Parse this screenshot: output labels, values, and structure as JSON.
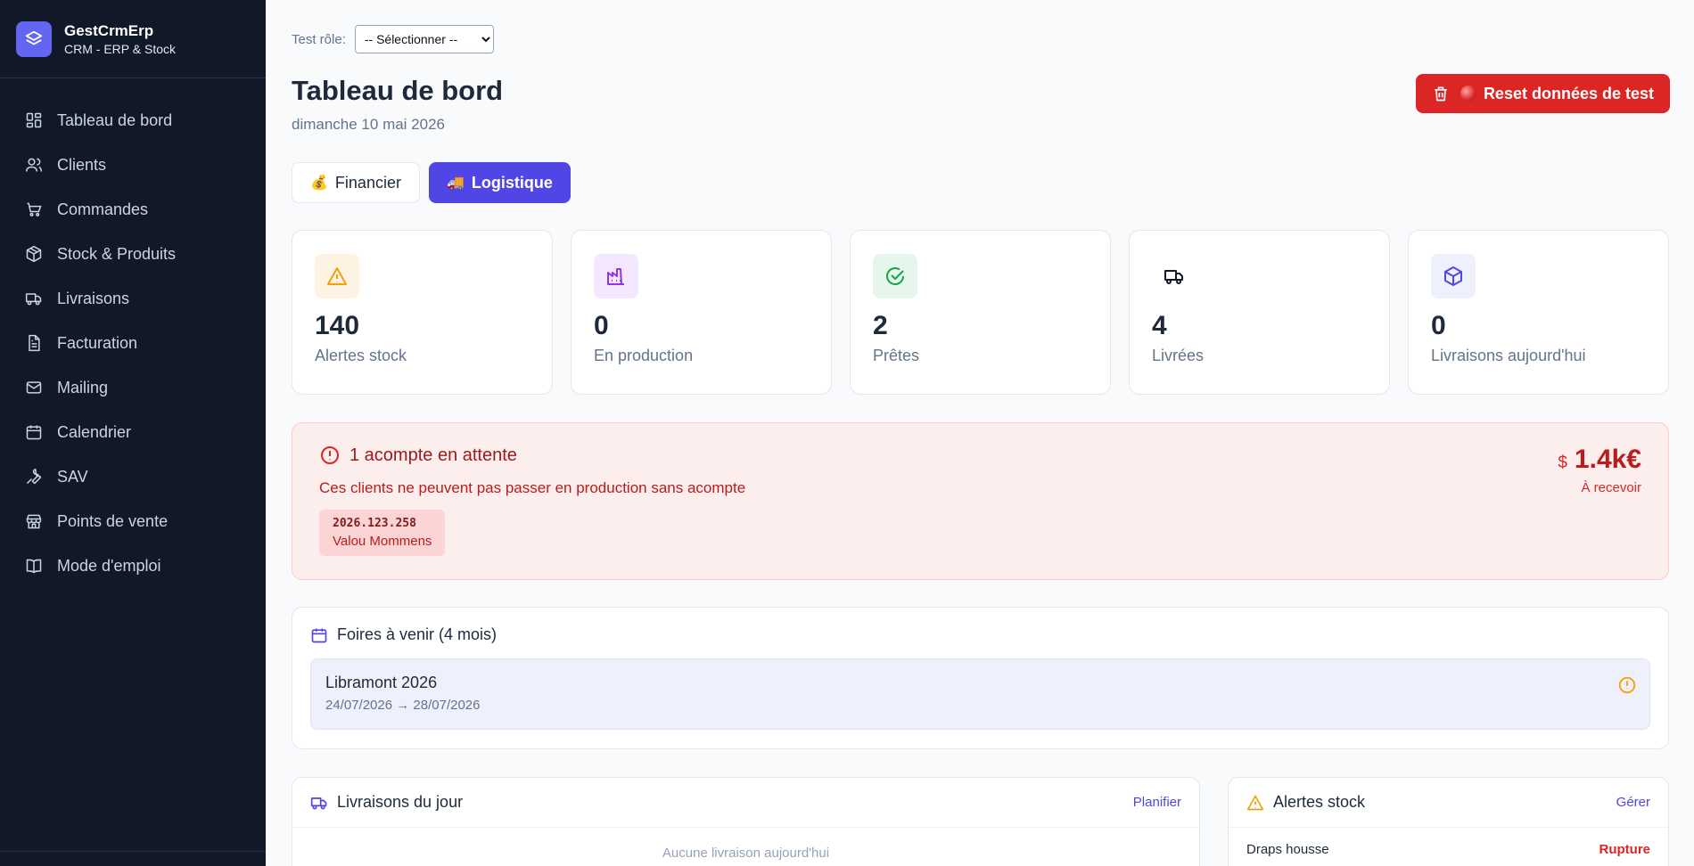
{
  "brand": {
    "name": "GestCrmErp",
    "subtitle": "CRM - ERP & Stock"
  },
  "sidebar": {
    "items": [
      {
        "label": "Tableau de bord",
        "icon": "dashboard-icon"
      },
      {
        "label": "Clients",
        "icon": "users-icon"
      },
      {
        "label": "Commandes",
        "icon": "cart-icon"
      },
      {
        "label": "Stock & Produits",
        "icon": "box-icon"
      },
      {
        "label": "Livraisons",
        "icon": "truck-icon"
      },
      {
        "label": "Facturation",
        "icon": "invoice-icon"
      },
      {
        "label": "Mailing",
        "icon": "mail-icon"
      },
      {
        "label": "Calendrier",
        "icon": "calendar-icon"
      },
      {
        "label": "SAV",
        "icon": "wrench-icon"
      },
      {
        "label": "Points de vente",
        "icon": "store-icon"
      },
      {
        "label": "Mode d'emploi",
        "icon": "book-icon"
      }
    ]
  },
  "header": {
    "role_label": "Test rôle:",
    "role_select_value": "-- Sélectionner --",
    "title": "Tableau de bord",
    "date": "dimanche 10 mai 2026",
    "reset_label": "Reset données de test"
  },
  "tabs": [
    {
      "emoji": "💰",
      "label": "Financier",
      "active": false
    },
    {
      "emoji": "🚚",
      "label": "Logistique",
      "active": true
    }
  ],
  "stats": [
    {
      "value": "140",
      "label": "Alertes stock",
      "icon": "warning-icon",
      "color": "#f59e0b",
      "bg": "#fef3e2"
    },
    {
      "value": "0",
      "label": "En production",
      "icon": "factory-icon",
      "color": "#9333ea",
      "bg": "#f3e8ff"
    },
    {
      "value": "2",
      "label": "Prêtes",
      "icon": "check-circle-icon",
      "color": "#16a34a",
      "bg": "#e7f6ec"
    },
    {
      "value": "4",
      "label": "Livrées",
      "icon": "truck-icon",
      "color": "#111827",
      "bg": "#ffffff"
    },
    {
      "value": "0",
      "label": "Livraisons aujourd'hui",
      "icon": "package-icon",
      "color": "#4f46e5",
      "bg": "#eef0fd"
    }
  ],
  "deposit_alert": {
    "title": "1 acompte en attente",
    "text": "Ces clients ne peuvent pas passer en production sans acompte",
    "order_code": "2026.123.258",
    "client": "Valou Mommens",
    "amount_symbol": "$",
    "amount": "1.4k€",
    "amount_label": "À recevoir"
  },
  "fairs": {
    "title": "Foires à venir (4 mois)",
    "items": [
      {
        "name": "Libramont 2026",
        "dates": "24/07/2026 → 28/07/2026"
      }
    ]
  },
  "deliveries_panel": {
    "title": "Livraisons du jour",
    "link": "Planifier",
    "empty": "Aucune livraison aujourd'hui"
  },
  "stock_panel": {
    "title": "Alertes stock",
    "link": "Gérer",
    "rows": [
      {
        "name": "Draps housse",
        "status": "Rupture"
      }
    ]
  },
  "colors": {
    "sidebar_bg": "#111827",
    "accent": "#4f46e5",
    "danger": "#dc2626"
  }
}
